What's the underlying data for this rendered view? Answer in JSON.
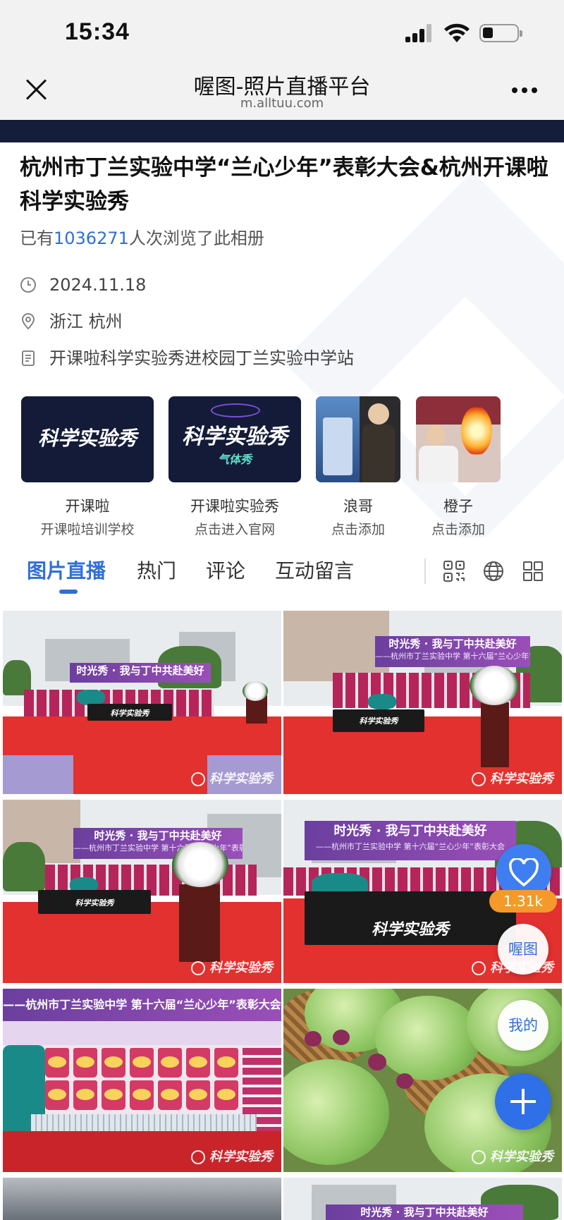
{
  "status_bar": {
    "time": "15:34"
  },
  "nav": {
    "title": "喔图-照片直播平台",
    "url": "m.alltuu.com"
  },
  "album": {
    "title": "杭州市丁兰实验中学“兰心少年”表彰大会&杭州开课啦科学实验秀",
    "views_prefix": "已有",
    "views_count": "1036271",
    "views_suffix": "人次浏览了此相册",
    "date": "2024.11.18",
    "location": "浙江 杭州",
    "description": "开课啦科学实验秀进校园丁兰实验中学站"
  },
  "cards": [
    {
      "logo": "科学实验秀",
      "name": "开课啦",
      "sub": "开课啦培训学校"
    },
    {
      "logo": "科学实验秀",
      "logo_sub": "气体秀",
      "name": "开课啦实验秀",
      "sub": "点击进入官网"
    },
    {
      "name": "浪哥",
      "sub": "点击添加"
    },
    {
      "name": "橙子",
      "sub": "点击添加"
    }
  ],
  "tabs": [
    {
      "label": "图片直播",
      "active": true
    },
    {
      "label": "热门"
    },
    {
      "label": "评论"
    },
    {
      "label": "互动留言"
    }
  ],
  "photos": {
    "banner_text": "时光秀 · 我与丁中共赴美好",
    "banner_sub": "——杭州市丁兰实验中学 第十六届“兰心少年”表彰大会",
    "table_logo": "科学实验秀",
    "watermark": "科学实验秀"
  },
  "fab": {
    "like_count": "1.31k",
    "home_label": "喔图",
    "mine_label": "我的"
  },
  "colors": {
    "accent": "#2f6fd8",
    "dark_navy": "#141b38",
    "like_orange": "#f39a2a"
  }
}
